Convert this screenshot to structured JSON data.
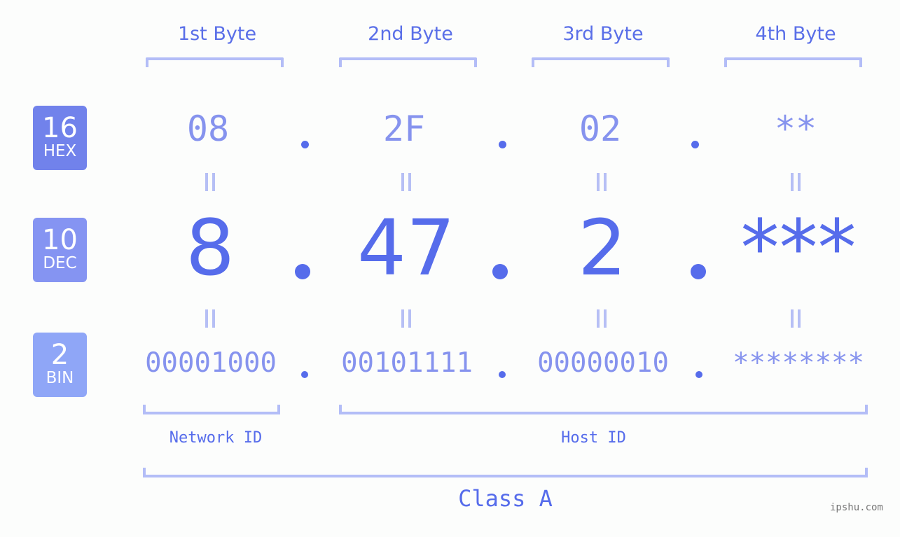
{
  "bytes": {
    "headers": [
      "1st Byte",
      "2nd Byte",
      "3rd Byte",
      "4th Byte"
    ]
  },
  "bases": [
    {
      "num": "16",
      "label": "HEX",
      "color": "#7182eb"
    },
    {
      "num": "10",
      "label": "DEC",
      "color": "#8594f2"
    },
    {
      "num": "2",
      "label": "BIN",
      "color": "#8fa6f7"
    }
  ],
  "hex": [
    "08",
    "2F",
    "02",
    "**"
  ],
  "dec": [
    "8",
    "47",
    "2",
    "***"
  ],
  "bin": [
    "00001000",
    "00101111",
    "00000010",
    "********"
  ],
  "separator": ".",
  "parts": {
    "network": "Network ID",
    "host": "Host ID",
    "class": "Class A"
  },
  "watermark": "ipshu.com",
  "colors": {
    "accent": "#566ceb",
    "light": "#8693ee",
    "bracket": "#b3bdf7"
  }
}
